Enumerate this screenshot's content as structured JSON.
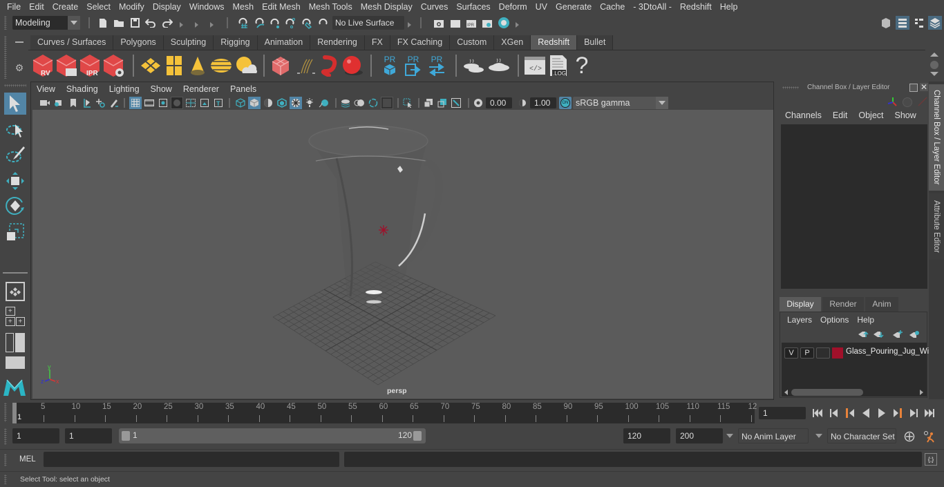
{
  "menubar": {
    "items": [
      "File",
      "Edit",
      "Create",
      "Select",
      "Modify",
      "Display",
      "Windows",
      "Mesh",
      "Edit Mesh",
      "Mesh Tools",
      "Mesh Display",
      "Curves",
      "Surfaces",
      "Deform",
      "UV",
      "Generate",
      "Cache",
      "- 3DtoAll -",
      "Redshift",
      "Help"
    ]
  },
  "statusline": {
    "mode_select": "Modeling",
    "live_surface": "No Live Surface"
  },
  "shelf": {
    "tabs": [
      "Curves / Surfaces",
      "Polygons",
      "Sculpting",
      "Rigging",
      "Animation",
      "Rendering",
      "FX",
      "FX Caching",
      "Custom",
      "XGen",
      "Redshift",
      "Bullet"
    ],
    "active_tab": "Redshift",
    "icons": {
      "rv": "RV",
      "ipr": "IPR",
      "pr": "PR",
      "log": ".LOG",
      "help": "?"
    }
  },
  "viewport": {
    "menu": [
      "View",
      "Shading",
      "Lighting",
      "Show",
      "Renderer",
      "Panels"
    ],
    "exposure": "0.00",
    "gamma": "1.00",
    "color_mgmt_badge": "ON",
    "color_space": "sRGB gamma",
    "camera_label": "persp",
    "axis": {
      "x": "x",
      "y": "y",
      "z": "z"
    }
  },
  "channel_box": {
    "title": "Channel Box / Layer Editor",
    "menu": [
      "Channels",
      "Edit",
      "Object",
      "Show"
    ]
  },
  "layer_editor": {
    "tabs": [
      "Display",
      "Render",
      "Anim"
    ],
    "active_tab": "Display",
    "menu": [
      "Layers",
      "Options",
      "Help"
    ],
    "layers": [
      {
        "v": "V",
        "p": "P",
        "color": "#a0102a",
        "name": "Glass_Pouring_Jug_Wi"
      }
    ]
  },
  "side_tabs": [
    "Channel Box / Layer Editor",
    "Attribute Editor"
  ],
  "timeline": {
    "current_frame_marker": "1",
    "ticks": [
      "5",
      "10",
      "15",
      "20",
      "25",
      "30",
      "35",
      "40",
      "45",
      "50",
      "55",
      "60",
      "65",
      "70",
      "75",
      "80",
      "85",
      "90",
      "95",
      "100",
      "105",
      "110",
      "115",
      "12"
    ],
    "current_frame": "1"
  },
  "range": {
    "start": "1",
    "playback_start": "1",
    "slider_start": "1",
    "slider_end": "120",
    "playback_end": "120",
    "end": "200",
    "anim_layer": "No Anim Layer",
    "character_set": "No Character Set"
  },
  "cmdline": {
    "lang": "MEL",
    "input": "",
    "output": ""
  },
  "helpline": {
    "text": "Select Tool: select an object"
  },
  "colors": {
    "accent_blue": "#5285a6",
    "redshift_red": "#e03c3c",
    "teal": "#3fb0c0",
    "playback_orange": "#e8823a",
    "layer_color": "#a0102a"
  }
}
